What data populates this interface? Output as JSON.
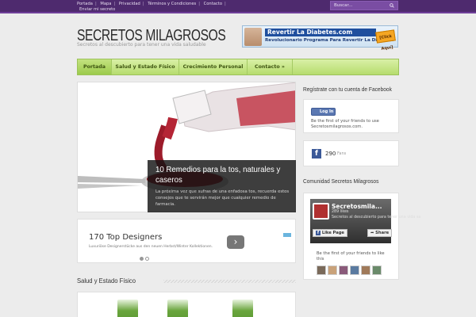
{
  "topbar": {
    "links": [
      "Portada",
      "Mapa",
      "Privacidad",
      "Términos y Condiciones",
      "Contacto"
    ],
    "second_line": "Enviar mi secreto",
    "search_placeholder": "Buscar..."
  },
  "header": {
    "title": "SECRETOS MILAGROSOS",
    "tagline": "Secretos al descubierto para tener una vida saludable",
    "banner": {
      "line1": "Revertir La Diabetes.com",
      "line2": "Revolucionario Programa Para Revertir La Diabetes",
      "cta": "[Click Aquí]"
    }
  },
  "nav": {
    "items": [
      {
        "label": "Portada"
      },
      {
        "label": "Salud y Estado Físico"
      },
      {
        "label": "Crecimiento Personal"
      },
      {
        "label": "Contacto »"
      }
    ]
  },
  "slider": {
    "title": "10 Remedios para la tos, naturales y caseros",
    "description": "La próxima vez que sufras de una enfadosa tos, recuerda estos consejos que te servirán mejor que cualquier remedio de farmacia."
  },
  "ad": {
    "title": "170 Top Designers",
    "subtitle": "Luxuriöse Designerstücke aus den neuen Herbst/Winter Kollektionen.",
    "next": "›"
  },
  "section": {
    "title": "Salud y Estado Físico"
  },
  "sidebar": {
    "facebook_register": {
      "heading": "Regístrate con tu cuenta de Facebook",
      "login_label": "Log In",
      "text_line1": "Be the first of your friends to use",
      "text_line2": "Secretosmilagrosos.com."
    },
    "fans": {
      "count": "290",
      "label": "Fans"
    },
    "community": {
      "heading": "Comunidad Secretos Milagrosos",
      "page_name": "Secretosmila...",
      "page_likes": "289 likes",
      "page_desc": "Secretos al descubierto para tener una vida sa",
      "like_label": "Like Page",
      "share_label": "Share",
      "friends_text": "Be the first of your friends to like this"
    }
  }
}
